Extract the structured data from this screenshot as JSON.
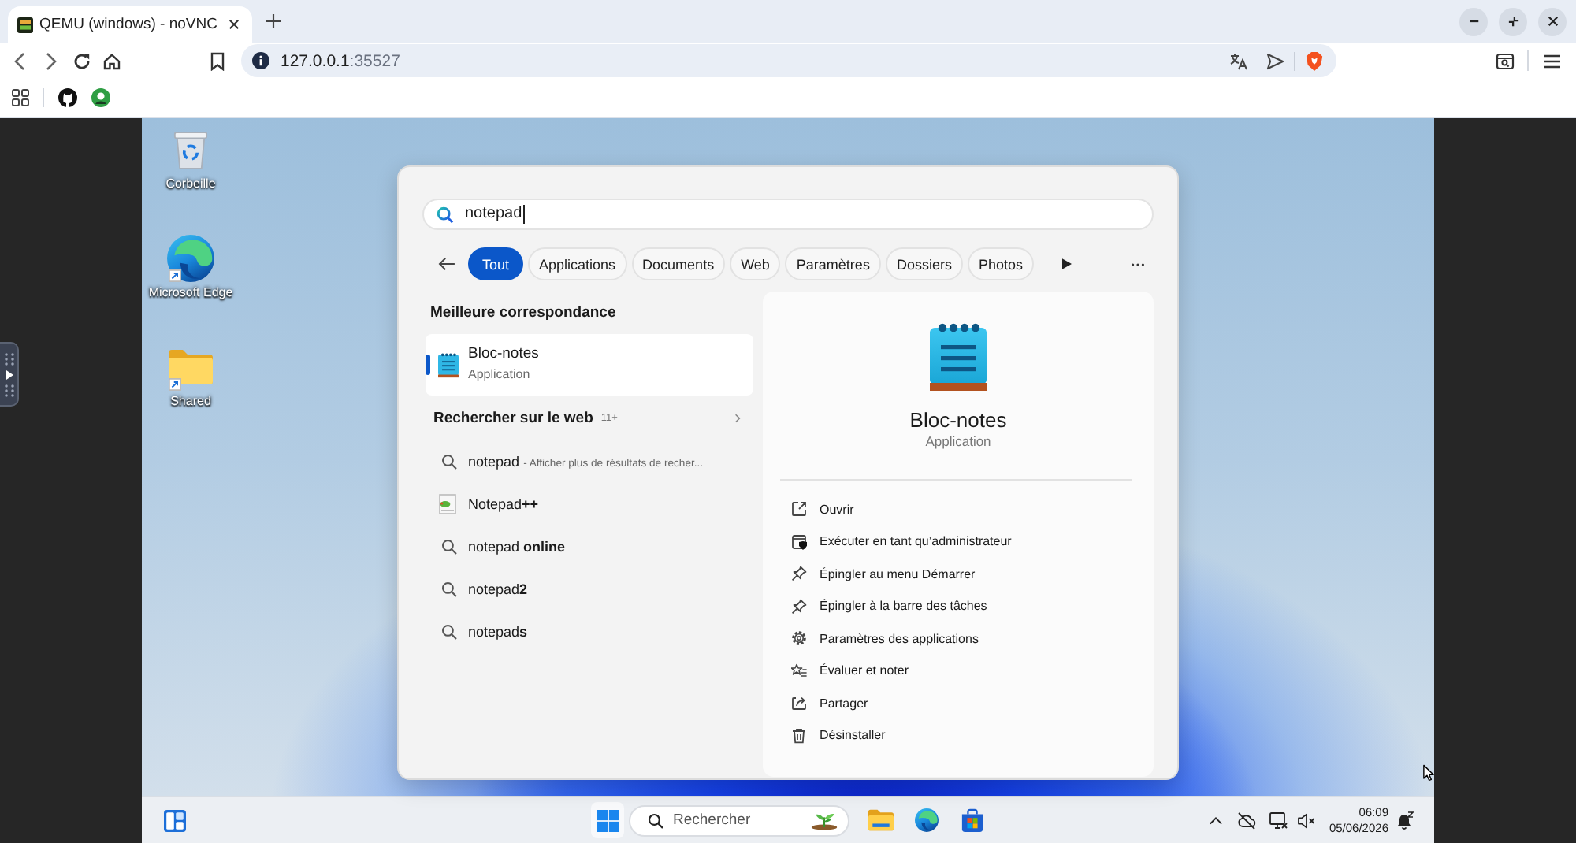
{
  "browser": {
    "tab_title": "QEMU (windows) - noVNC",
    "address": {
      "host": "127.0.0.1",
      "port": ":35527"
    }
  },
  "desktop": {
    "icons": [
      {
        "kind": "trash",
        "label": "Corbeille",
        "shortcut": false
      },
      {
        "kind": "browser",
        "label": "Microsoft Edge",
        "shortcut": true
      },
      {
        "kind": "folder",
        "label": "Shared",
        "shortcut": true
      }
    ]
  },
  "search": {
    "query": "notepad",
    "filters": [
      {
        "label": "Tout",
        "selected": true
      },
      {
        "label": "Applications",
        "selected": false
      },
      {
        "label": "Documents",
        "selected": false
      },
      {
        "label": "Web",
        "selected": false
      },
      {
        "label": "Paramètres",
        "selected": false
      },
      {
        "label": "Dossiers",
        "selected": false
      },
      {
        "label": "Photos",
        "selected": false
      }
    ],
    "best_match": {
      "heading": "Meilleure correspondance",
      "name": "Bloc-notes",
      "type": "Application",
      "selected": true
    },
    "web": {
      "heading": "Rechercher sur le web",
      "count": "11+",
      "results": [
        {
          "kind": "search",
          "text": "notepad",
          "hint": "- Afficher plus de résultats de recher..."
        },
        {
          "kind": "app",
          "text": "Notepad**++**"
        },
        {
          "kind": "search",
          "text": "notepad **online**"
        },
        {
          "kind": "search",
          "text": "notepad**2**"
        },
        {
          "kind": "search",
          "text": "notepad**s**"
        }
      ]
    },
    "details": {
      "name": "Bloc-notes",
      "type": "Application",
      "actions": [
        {
          "kind": "open",
          "label": "Ouvrir"
        },
        {
          "kind": "admin",
          "label": "Exécuter en tant qu’administrateur"
        },
        {
          "kind": "pin",
          "label": "Épingler au menu Démarrer"
        },
        {
          "kind": "pin",
          "label": "Épingler à la barre des tâches"
        },
        {
          "kind": "settings",
          "label": "Paramètres des applications"
        },
        {
          "kind": "rate",
          "label": "Évaluer et noter"
        },
        {
          "kind": "share",
          "label": "Partager"
        },
        {
          "kind": "uninstall",
          "label": "Désinstaller"
        }
      ]
    }
  },
  "taskbar": {
    "search": {
      "placeholder": "Rechercher"
    },
    "clock": {
      "time": "06:09",
      "date": "05/06/2026"
    }
  }
}
